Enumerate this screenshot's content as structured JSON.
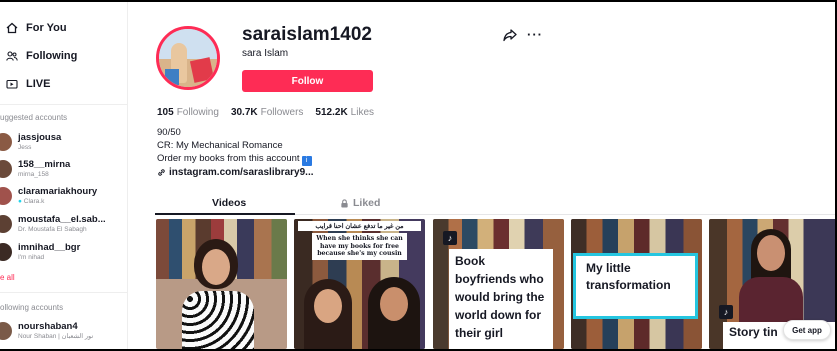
{
  "nav": {
    "for_you": "For You",
    "following": "Following",
    "live": "LIVE"
  },
  "suggested": {
    "label": "uggested accounts",
    "accounts": [
      {
        "username": "jassjousa",
        "display": "Jess"
      },
      {
        "username": "158__mirna",
        "display": "mirna_158"
      },
      {
        "username": "claramariakhoury",
        "display": "Clara.k"
      },
      {
        "username": "moustafa__el.sab...",
        "display": "Dr. Moustafa El Sabagh"
      },
      {
        "username": "imnihad__bgr",
        "display": "I'm nihad"
      }
    ],
    "see_all": "e all"
  },
  "following_accounts": {
    "label": "ollowing accounts",
    "accounts": [
      {
        "username": "nourshaban4",
        "display": "Nour Shaban | نور الشعبان"
      }
    ]
  },
  "profile": {
    "username": "saraislam1402",
    "display_name": "sara Islam",
    "follow_label": "Follow",
    "stats": {
      "following_count": "105",
      "following_label": "Following",
      "followers_count": "30.7K",
      "followers_label": "Followers",
      "likes_count": "512.2K",
      "likes_label": "Likes"
    },
    "bio": {
      "line1": "90/50",
      "line2": "CR: My Mechanical Romance",
      "line3": "Order my books from this account",
      "badge": "i"
    },
    "link": "instagram.com/saraslibrary9..."
  },
  "tabs": {
    "videos": "Videos",
    "liked": "Liked"
  },
  "videos": [
    {
      "caption": ""
    },
    {
      "caption": "When she thinks she can have my books for free because she's my cousin",
      "caption_ar": "من غير ما تدفع عشان احنا قرايب"
    },
    {
      "caption": "Book boyfriends who would bring the world down for their girl"
    },
    {
      "caption": "My little transformation"
    },
    {
      "caption": "Story tin"
    }
  ],
  "get_app": "Get app",
  "colors": {
    "brand": "#fe2c55",
    "text": "#161823",
    "muted": "#8a8b91",
    "transformation_border": "#25c6e0"
  }
}
